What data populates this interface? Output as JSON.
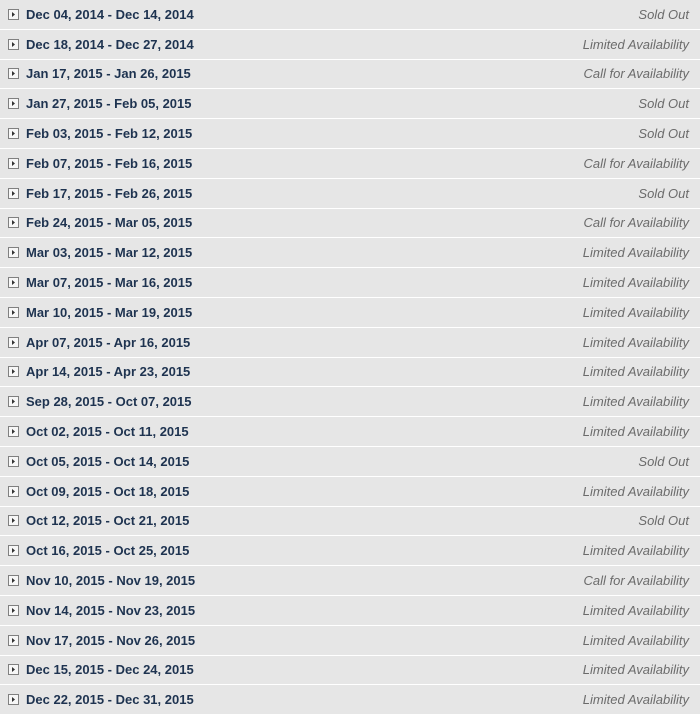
{
  "icons": {
    "expand": "expand-arrow-icon"
  },
  "colors": {
    "date_text": "#1e3350",
    "status_text": "#6b6b6b",
    "row_bg": "#e6e6e6",
    "separator": "#ffffff"
  },
  "departures": [
    {
      "dates": "Dec 04, 2014 - Dec 14, 2014",
      "status": "Sold Out"
    },
    {
      "dates": "Dec 18, 2014 - Dec 27, 2014",
      "status": "Limited Availability"
    },
    {
      "dates": "Jan 17, 2015 - Jan 26, 2015",
      "status": "Call for Availability"
    },
    {
      "dates": "Jan 27, 2015 - Feb 05, 2015",
      "status": "Sold Out"
    },
    {
      "dates": "Feb 03, 2015 - Feb 12, 2015",
      "status": "Sold Out"
    },
    {
      "dates": "Feb 07, 2015 - Feb 16, 2015",
      "status": "Call for Availability"
    },
    {
      "dates": "Feb 17, 2015 - Feb 26, 2015",
      "status": "Sold Out"
    },
    {
      "dates": "Feb 24, 2015 - Mar 05, 2015",
      "status": "Call for Availability"
    },
    {
      "dates": "Mar 03, 2015 - Mar 12, 2015",
      "status": "Limited Availability"
    },
    {
      "dates": "Mar 07, 2015 - Mar 16, 2015",
      "status": "Limited Availability"
    },
    {
      "dates": "Mar 10, 2015 - Mar 19, 2015",
      "status": "Limited Availability"
    },
    {
      "dates": "Apr 07, 2015 - Apr 16, 2015",
      "status": "Limited Availability"
    },
    {
      "dates": "Apr 14, 2015 - Apr 23, 2015",
      "status": "Limited Availability"
    },
    {
      "dates": "Sep 28, 2015 - Oct 07, 2015",
      "status": "Limited Availability"
    },
    {
      "dates": "Oct 02, 2015 - Oct 11, 2015",
      "status": "Limited Availability"
    },
    {
      "dates": "Oct 05, 2015 - Oct 14, 2015",
      "status": "Sold Out"
    },
    {
      "dates": "Oct 09, 2015 - Oct 18, 2015",
      "status": "Limited Availability"
    },
    {
      "dates": "Oct 12, 2015 - Oct 21, 2015",
      "status": "Sold Out"
    },
    {
      "dates": "Oct 16, 2015 - Oct 25, 2015",
      "status": "Limited Availability"
    },
    {
      "dates": "Nov 10, 2015 - Nov 19, 2015",
      "status": "Call for Availability"
    },
    {
      "dates": "Nov 14, 2015 - Nov 23, 2015",
      "status": "Limited Availability"
    },
    {
      "dates": "Nov 17, 2015 - Nov 26, 2015",
      "status": "Limited Availability"
    },
    {
      "dates": "Dec 15, 2015 - Dec 24, 2015",
      "status": "Limited Availability"
    },
    {
      "dates": "Dec 22, 2015 - Dec 31, 2015",
      "status": "Limited Availability"
    }
  ]
}
